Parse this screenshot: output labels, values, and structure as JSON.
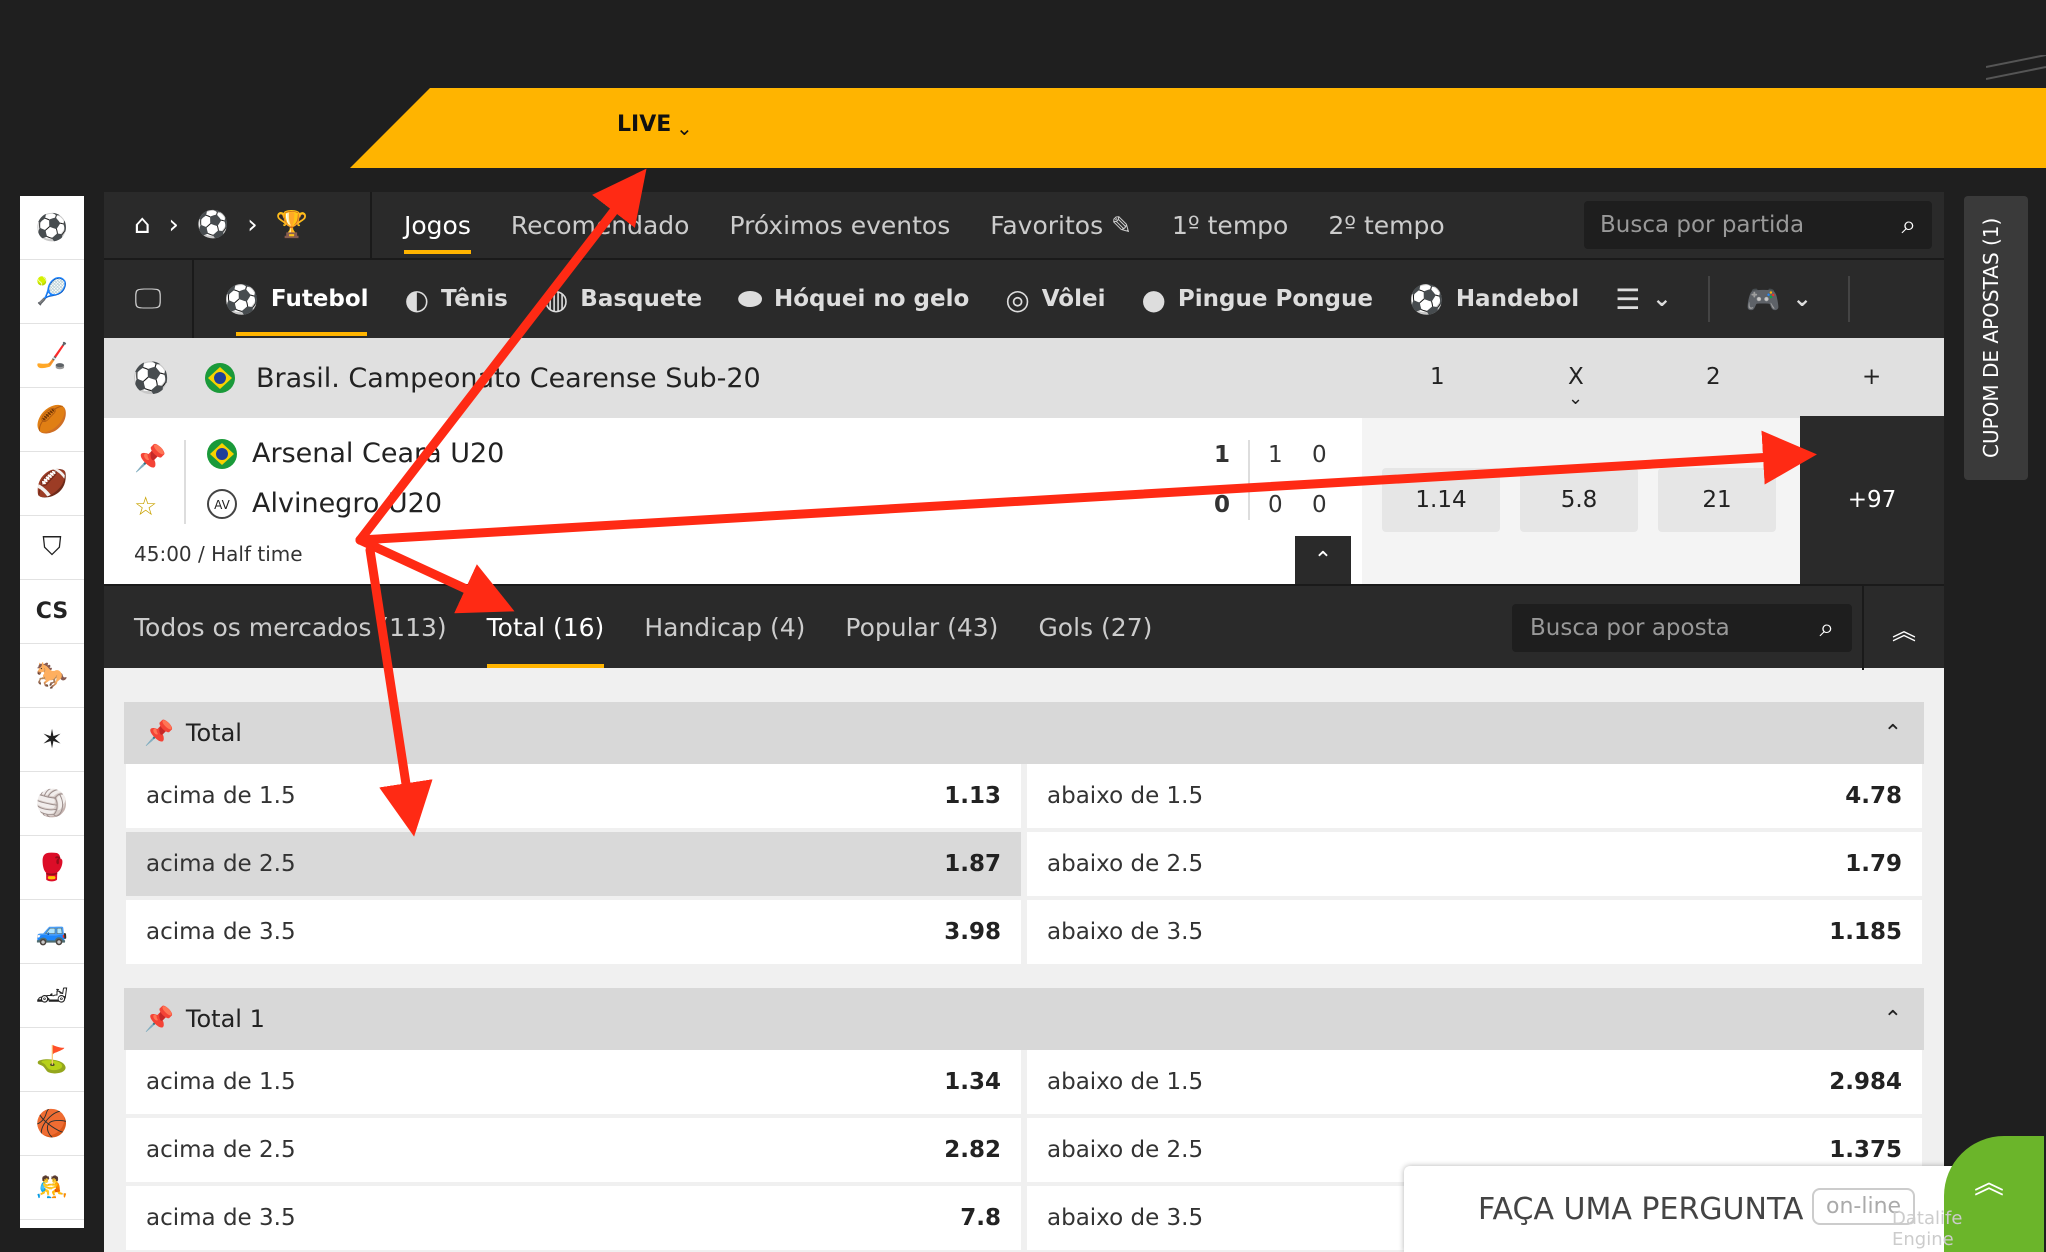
{
  "live": {
    "label": "LIVE"
  },
  "nav": {
    "tabs": [
      "Jogos",
      "Recomendado",
      "Próximos eventos",
      "Favoritos",
      "1º tempo",
      "2º tempo"
    ],
    "search_placeholder": "Busca por partida"
  },
  "sports": [
    "Futebol",
    "Tênis",
    "Basquete",
    "Hóquei no gelo",
    "Vôlei",
    "Pingue Pongue",
    "Handebol"
  ],
  "league": {
    "name": "Brasil. Campeonato Cearense Sub-20",
    "col1": "1",
    "colx": "X",
    "col2": "2",
    "colplus": "+"
  },
  "match": {
    "home": "Arsenal Ceará U20",
    "away": "Alvinegro U20",
    "home_scores": [
      "1",
      "1",
      "0"
    ],
    "away_scores": [
      "0",
      "0",
      "0"
    ],
    "time": "45:00",
    "period": "/ Half time",
    "odds": [
      "1.14",
      "5.8",
      "21"
    ],
    "more": "+97"
  },
  "market_tabs": [
    {
      "label": "Todos os mercados",
      "count": "(113)"
    },
    {
      "label": "Total",
      "count": "(16)"
    },
    {
      "label": "Handicap",
      "count": "(4)"
    },
    {
      "label": "Popular",
      "count": "(43)"
    },
    {
      "label": "Gols",
      "count": "(27)"
    }
  ],
  "market_search_placeholder": "Busca por aposta",
  "groups": [
    {
      "title": "Total",
      "rows": [
        {
          "l": "acima de 1.5",
          "lv": "1.13",
          "r": "abaixo de 1.5",
          "rv": "4.78"
        },
        {
          "l": "acima de 2.5",
          "lv": "1.87",
          "r": "abaixo de 2.5",
          "rv": "1.79"
        },
        {
          "l": "acima de 3.5",
          "lv": "3.98",
          "r": "abaixo de 3.5",
          "rv": "1.185"
        }
      ]
    },
    {
      "title": "Total 1",
      "rows": [
        {
          "l": "acima de 1.5",
          "lv": "1.34",
          "r": "abaixo de 1.5",
          "rv": "2.984"
        },
        {
          "l": "acima de 2.5",
          "lv": "2.82",
          "r": "abaixo de 2.5",
          "rv": "1.375"
        },
        {
          "l": "acima de 3.5",
          "lv": "7.8",
          "r": "abaixo de 3.5",
          "rv": ""
        }
      ]
    }
  ],
  "coupon": {
    "label": "CUPOM DE APOSTAS (1)"
  },
  "ask": {
    "label": "FAÇA UMA PERGUNTA",
    "status": "on-line",
    "brand": "Datalife Engine"
  },
  "colors": {
    "accent": "#ffb400",
    "dark": "#2a2a2a",
    "arrow": "#ff2a14",
    "chat": "#6bb52a"
  },
  "icons": [
    "home-icon",
    "soccer-ball-icon",
    "trophy-icon",
    "search-icon",
    "pencil-icon",
    "pin-icon",
    "star-icon",
    "monitor-icon",
    "gamepad-icon",
    "menu-icon",
    "chevron-up-icon",
    "double-chevron-up-icon"
  ]
}
